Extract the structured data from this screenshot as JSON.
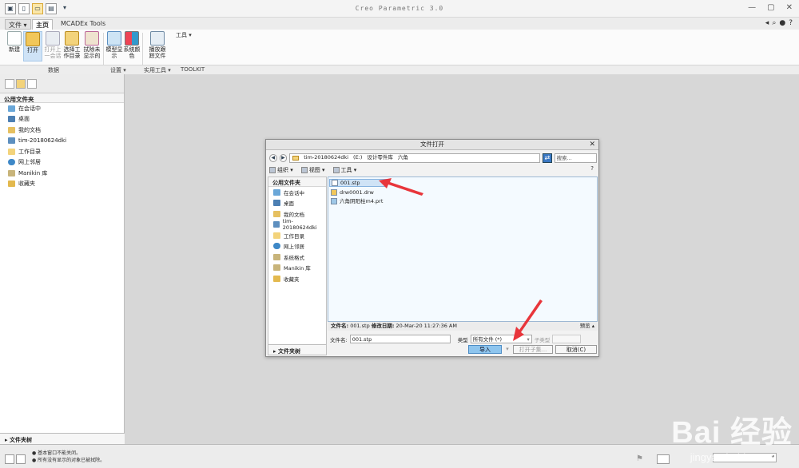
{
  "window": {
    "title": "Creo Parametric 3.0",
    "qat_dropdown": "▾"
  },
  "ribbon": {
    "tabs": [
      {
        "label": "文件 ▾"
      },
      {
        "label": "主页"
      },
      {
        "label": "MCADEx Tools"
      }
    ],
    "buttons": [
      {
        "label": "新建"
      },
      {
        "label": "打开"
      },
      {
        "label": "打开上一会话"
      },
      {
        "label": "选择工作目录"
      },
      {
        "label": "拭除未显示的"
      },
      {
        "label": "模型显示"
      },
      {
        "label": "系统颜色"
      },
      {
        "label": "播放跟踪文件"
      }
    ],
    "tools_dropdown": "工具 ▾",
    "groups": [
      {
        "label": "数据"
      },
      {
        "label": "设置 ▾"
      },
      {
        "label": "实用工具 ▾"
      },
      {
        "label": "TOOLKIT"
      }
    ]
  },
  "navigator": {
    "title": "公用文件夹",
    "items": [
      {
        "label": "在会话中"
      },
      {
        "label": "桌面"
      },
      {
        "label": "我的文档"
      },
      {
        "label": "tim-20180624dki"
      },
      {
        "label": "工作目录"
      },
      {
        "label": "网上邻居"
      },
      {
        "label": "Manikin 库"
      },
      {
        "label": "收藏夹"
      }
    ],
    "tree": "▸ 文件夹树"
  },
  "status": {
    "messages": [
      "● 基本窗口不能关闭。",
      "● 所有没有显示的对象已被拭除。"
    ]
  },
  "dialog": {
    "title": "文件打开",
    "close": "✕",
    "address": [
      "tim-20180624dki",
      "(E:)",
      "设计零件库",
      "六角"
    ],
    "search_placeholder": "搜索...",
    "toolbar": {
      "organize": "组织 ▾",
      "view": "视图 ▾",
      "tools": "工具 ▾",
      "help": "?"
    },
    "left": {
      "title": "公用文件夹",
      "items": [
        {
          "label": "在会话中"
        },
        {
          "label": "桌面"
        },
        {
          "label": "我的文档"
        },
        {
          "label": "tim-20180624dki"
        },
        {
          "label": "工作目录"
        },
        {
          "label": "网上邻居"
        },
        {
          "label": "系统格式"
        },
        {
          "label": "Manikin 库"
        },
        {
          "label": "收藏夹"
        }
      ],
      "tree": "▸ 文件夹树"
    },
    "files": [
      {
        "name": "001.stp"
      },
      {
        "name": "drw0001.drw"
      },
      {
        "name": "六角阴阳柱m4.prt"
      }
    ],
    "info": {
      "name_label": "文件名:",
      "name_value": "001.stp",
      "date_label": "修改日期:",
      "date_value": "20-Mar-20 11:27:36 AM",
      "preview": "预览 ▴"
    },
    "filename_label": "文件名:",
    "filename_value": "001.stp",
    "type_label": "类型",
    "type_value": "所有文件 (*)",
    "subtype_label": "子类型",
    "buttons": {
      "import": "导入",
      "open_sub": "打开子集...",
      "cancel": "取消(C)"
    }
  },
  "watermark": {
    "logo": "Bai 经验",
    "url": "jingyan.baidu.com"
  },
  "colors": {
    "arrow": "#e8353b",
    "selection": "#cfe3f6",
    "primary_button": "#8ec5ee"
  }
}
